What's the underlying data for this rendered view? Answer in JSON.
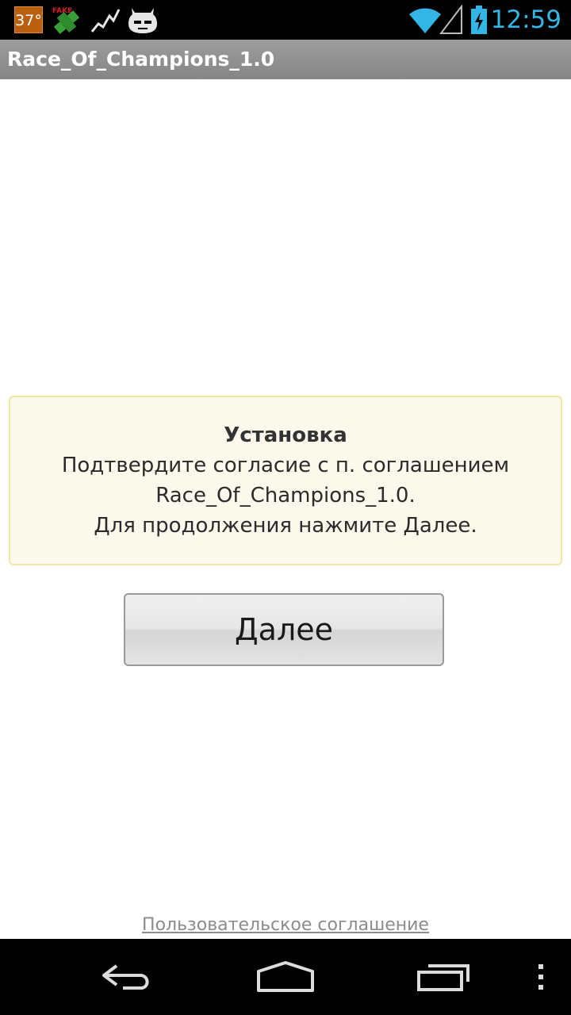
{
  "status_bar": {
    "temperature": "37°",
    "clock": "12:59",
    "icons": [
      "temperature-icon",
      "fake-gps-icon",
      "activity-graph-icon",
      "cyanogen-mascot-icon",
      "wifi-icon",
      "signal-icon",
      "battery-charging-icon"
    ],
    "clock_color": "#33b5e5"
  },
  "action_bar": {
    "title": "Race_Of_Champions_1.0"
  },
  "dialog": {
    "heading": "Установка",
    "line1": "Подтвердите согласие с п. соглашением",
    "line2": "Race_Of_Champions_1.0.",
    "line3": "Для продолжения нажмите Далее."
  },
  "buttons": {
    "next_label": "Далее"
  },
  "footer": {
    "agreement_link": "Пользовательское соглашение"
  },
  "nav_bar": {
    "icons": [
      "back-icon",
      "home-icon",
      "recent-apps-icon",
      "overflow-menu-icon"
    ]
  }
}
